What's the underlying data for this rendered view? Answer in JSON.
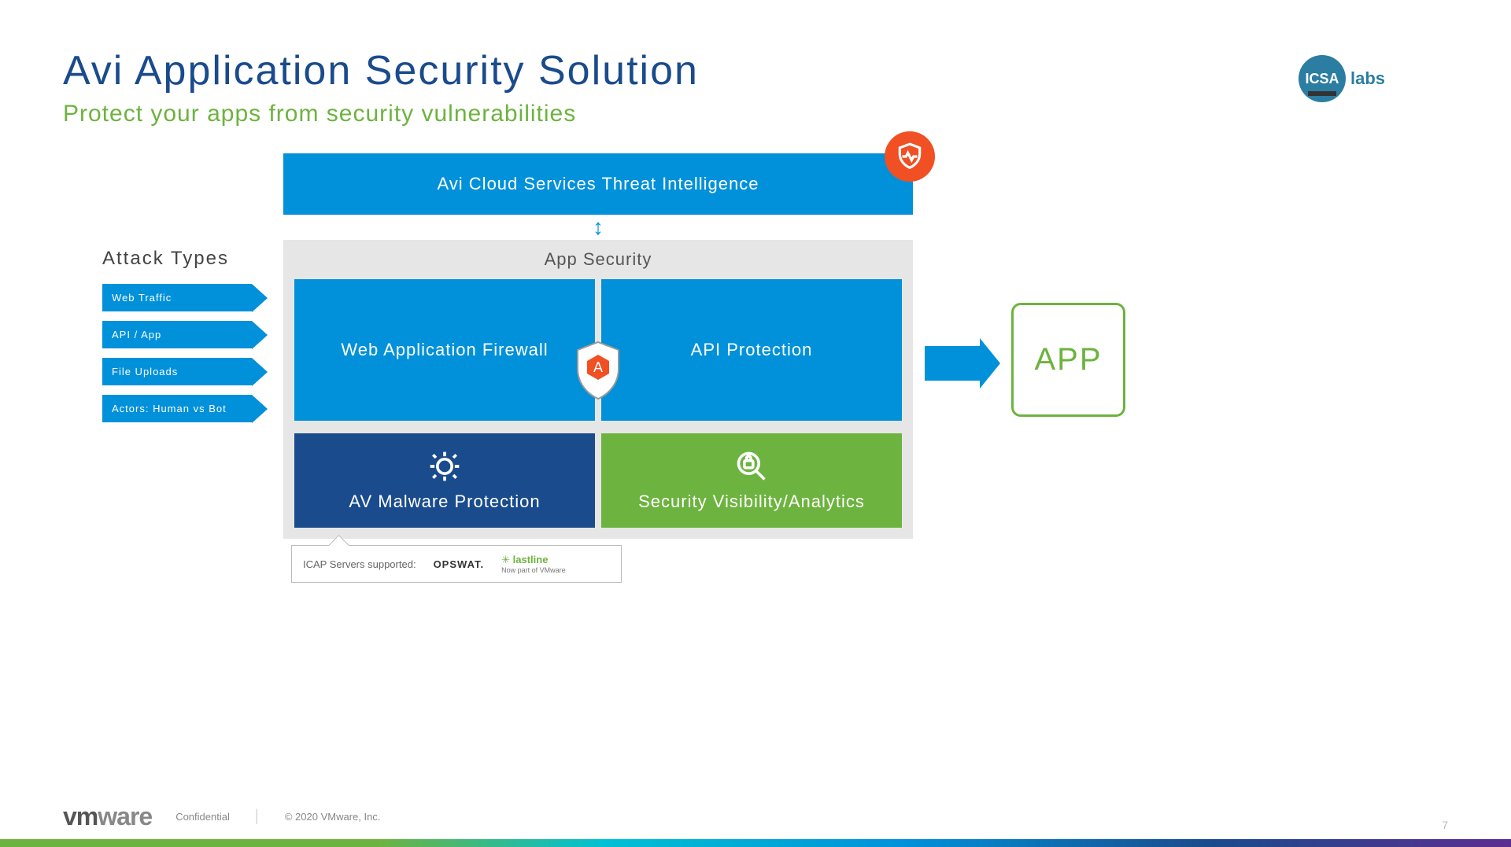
{
  "title": "Avi Application Security Solution",
  "subtitle": "Protect your apps from security vulnerabilities",
  "logo": {
    "icsa": "ICSA",
    "labs": "labs"
  },
  "attack": {
    "heading": "Attack Types",
    "items": [
      "Web Traffic",
      "API / App",
      "File Uploads",
      "Actors: Human vs Bot"
    ]
  },
  "diagram": {
    "cloud_bar": "Avi Cloud Services Threat Intelligence",
    "app_security_heading": "App Security",
    "cells": {
      "waf": "Web Application Firewall",
      "api": "API Protection",
      "av": "AV Malware Protection",
      "viz": "Security Visibility/Analytics"
    },
    "icap": {
      "label": "ICAP Servers supported:",
      "vendor1": "OPSWAT.",
      "vendor2": "lastline",
      "vendor2_sub": "Now part of VMware"
    }
  },
  "app_box": "APP",
  "footer": {
    "vmware": "vmware",
    "confidential": "Confidential",
    "copyright": "© 2020 VMware, Inc.",
    "page": "7"
  }
}
